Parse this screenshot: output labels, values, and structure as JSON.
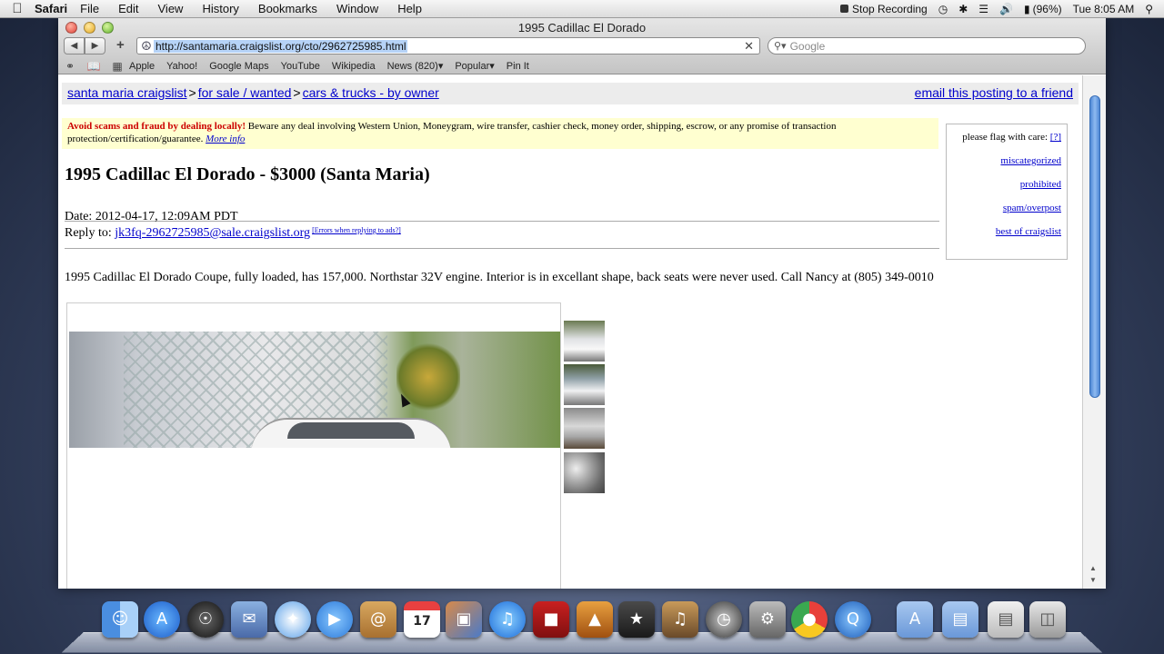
{
  "menubar": {
    "app": "Safari",
    "menus": [
      "File",
      "Edit",
      "View",
      "History",
      "Bookmarks",
      "Window",
      "Help"
    ],
    "status": {
      "recording": "Stop Recording",
      "battery": "(96%)",
      "clock": "Tue 8:05 AM"
    }
  },
  "window": {
    "title": "1995 Cadillac El Dorado",
    "url": "http://santamaria.craigslist.org/cto/2962725985.html",
    "search_placeholder": "Google",
    "bookmarks": [
      "Apple",
      "Yahoo!",
      "Google Maps",
      "YouTube",
      "Wikipedia",
      "News (820)",
      "Popular",
      "Pin It"
    ]
  },
  "page": {
    "breadcrumb": [
      "santa maria craigslist",
      "for sale / wanted",
      "cars & trucks - by owner"
    ],
    "breadcrumb_sep": ">",
    "email_link": "email this posting to a friend",
    "scam": {
      "bold": "Avoid scams and fraud by dealing locally!",
      "text": " Beware any deal involving Western Union, Moneygram, wire transfer, cashier check, money order, shipping, escrow, or any promise of transaction protection/certification/guarantee.",
      "more": "More info"
    },
    "flag": {
      "title": "please flag with care:",
      "help": "[?]",
      "options": [
        "miscategorized",
        "prohibited",
        "spam/overpost",
        "best of craigslist"
      ]
    },
    "title": "1995 Cadillac El Dorado - $3000 (Santa Maria)",
    "date": "Date: 2012-04-17, 12:09AM PDT",
    "reply_label": "Reply to: ",
    "reply_email": "jk3fq-2962725985@sale.craigslist.org",
    "reply_errors": "[Errors when replying to ads?]",
    "body": "1995 Cadillac El Dorado Coupe, fully loaded, has 157,000. Northstar 32V engine. Interior is in excellant shape, back seats were never used. Call Nancy at (805) 349-0010"
  },
  "dock": {
    "calendar_day": "17"
  }
}
